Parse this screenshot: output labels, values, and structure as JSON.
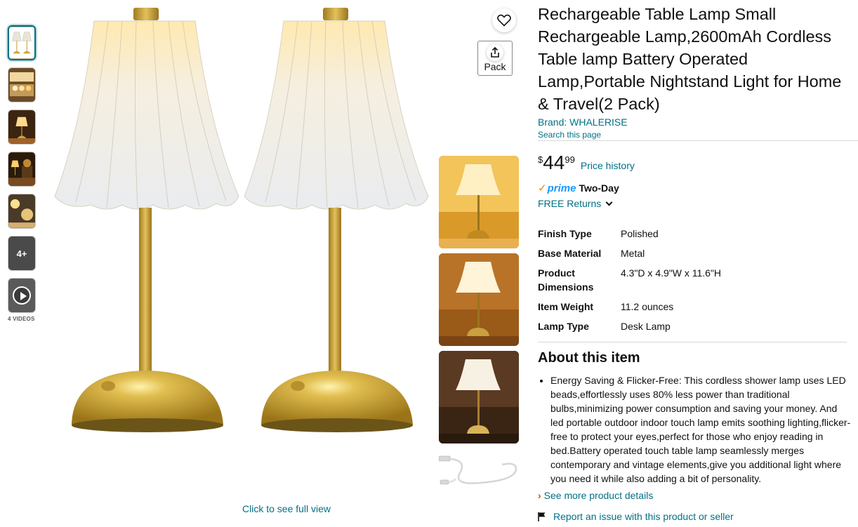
{
  "thumbnails": {
    "more_label": "4+",
    "videos_label": "4 VIDEOS"
  },
  "main_image": {
    "full_view_label": "Click to see full view"
  },
  "share": {
    "pack_label": "Pack"
  },
  "product": {
    "title": "Rechargeable Table Lamp Small Rechargeable Lamp,2600mAh Cordless Table lamp Battery Operated Lamp,Portable Nightstand Light for Home & Travel(2 Pack)",
    "brand": "Brand: WHALERISE",
    "search_page": "Search this page",
    "price_symbol": "$",
    "price_whole": "44",
    "price_fraction": "99",
    "price_history": "Price history",
    "prime_check": "✓",
    "prime_word": "prime",
    "prime_delivery": "Two-Day",
    "free_returns": "FREE Returns"
  },
  "specs": [
    {
      "key": "Finish Type",
      "value": "Polished"
    },
    {
      "key": "Base Material",
      "value": "Metal"
    },
    {
      "key": "Product Dimensions",
      "value": "4.3\"D x 4.9\"W x 11.6\"H"
    },
    {
      "key": "Item Weight",
      "value": "11.2 ounces"
    },
    {
      "key": "Lamp Type",
      "value": "Desk Lamp"
    }
  ],
  "about": {
    "heading": "About this item",
    "bullets": [
      "Energy Saving & Flicker-Free: This cordless shower lamp uses LED beads,effortlessly uses 80% less power than traditional bulbs,minimizing power consumption and saving your money. And led portable outdoor indoor touch lamp emits soothing lighting,flicker-free to protect your eyes,perfect for those who enjoy reading in bed.Battery operated touch table lamp seamlessly merges contemporary and vintage elements,give you additional light where you need it while also adding a bit of personality."
    ],
    "see_more_arrow": "›",
    "see_more": "See more product details",
    "report": "Report an issue with this product or seller"
  },
  "colors": {
    "link": "#007185",
    "prime_blue": "#1a98ff",
    "prime_orange": "#f08804",
    "brass": "#c9a33a"
  },
  "icons": {
    "heart": "heart-icon",
    "share": "share-icon",
    "play": "play-icon",
    "flag": "flag-icon",
    "chevron": "chevron-down-icon"
  }
}
